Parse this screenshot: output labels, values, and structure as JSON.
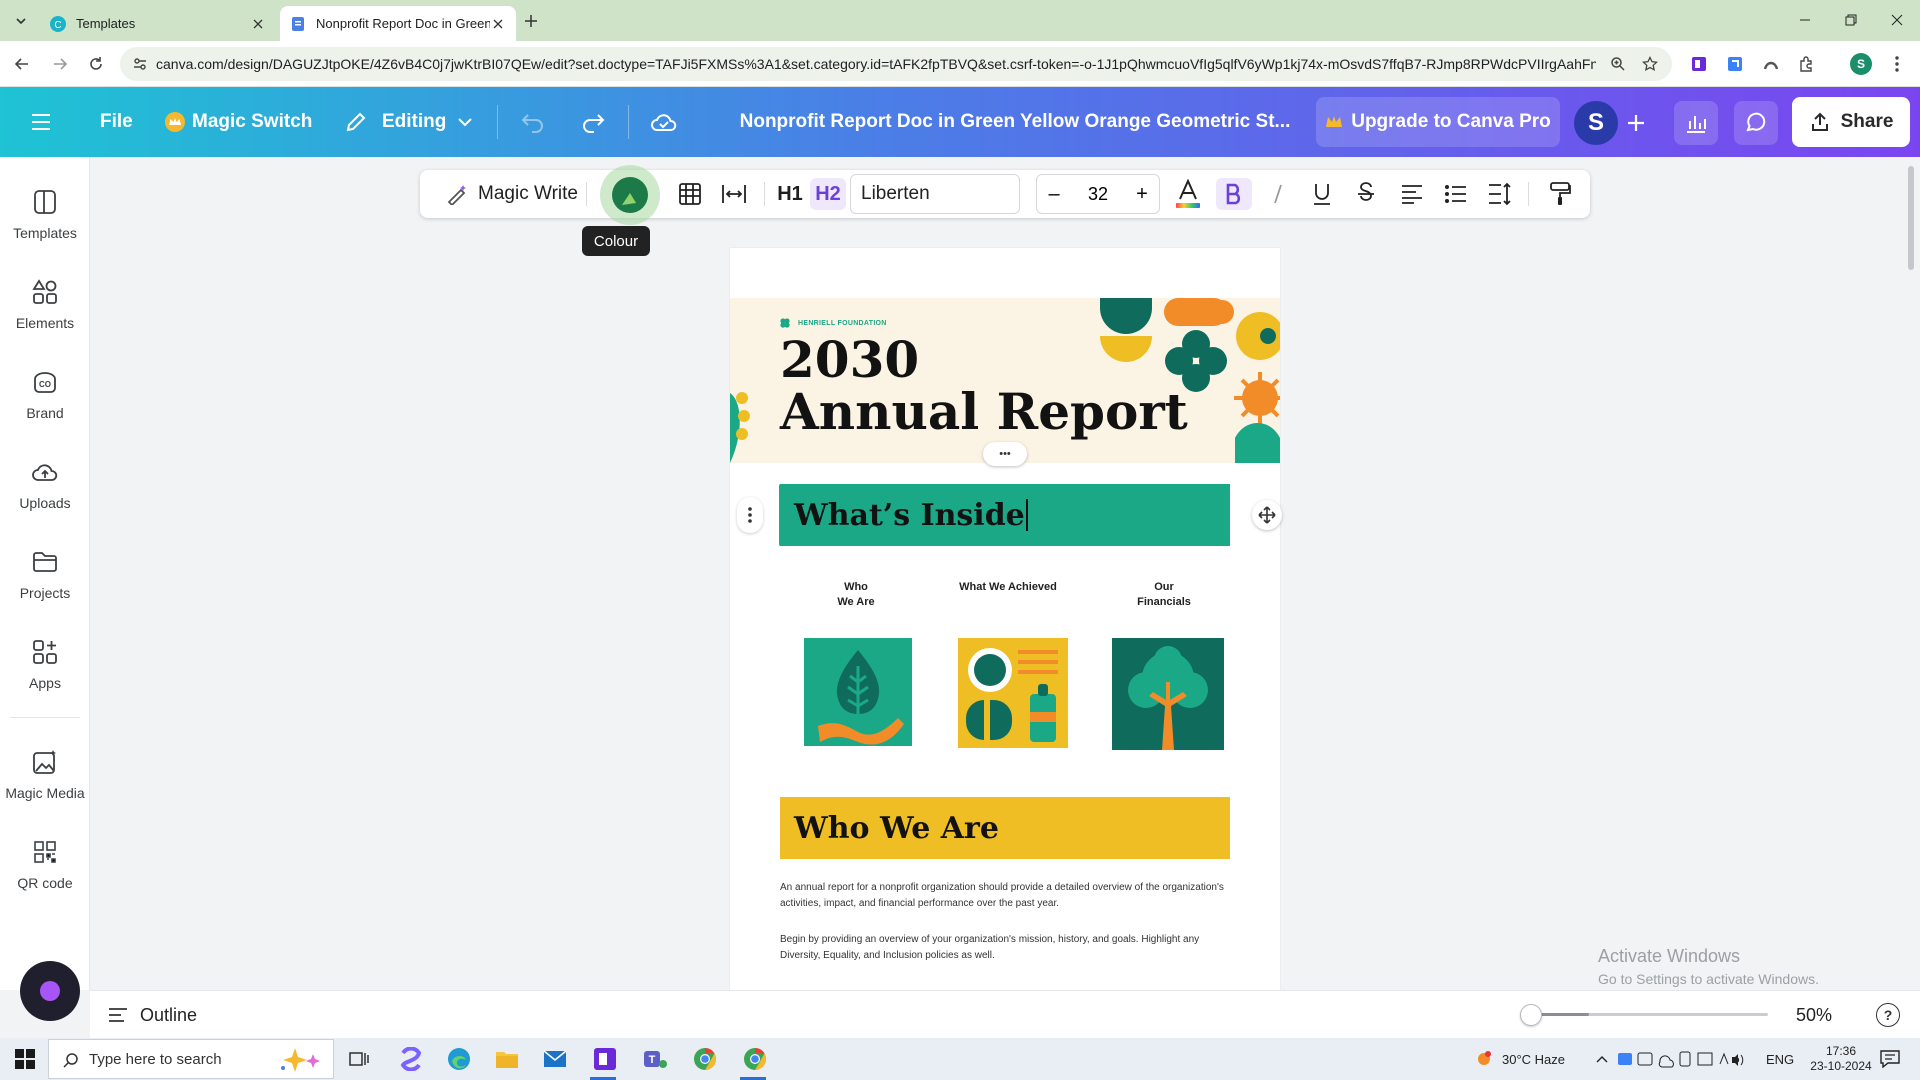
{
  "browser": {
    "tabs": [
      {
        "title": "Templates"
      },
      {
        "title": "Nonprofit Report Doc in Green"
      }
    ],
    "url": "canva.com/design/DAGUZJtpOKE/4Z6vB4C0j7jwKtrBI07QEw/edit?set.doctype=TAFJi5FXMSs%3A1&set.category.id=tAFK2fpTBVQ&set.csrf-token=-o-1J1pQhwmcuoVfIg5qlfV6yWp1kj74x-mOsvdS7ffqB7-RJmp8RPWdcPVIIrgAahFnOkE..."
  },
  "header": {
    "file": "File",
    "magic_switch": "Magic Switch",
    "editing": "Editing",
    "doc_title": "Nonprofit Report Doc in Green Yellow Orange Geometric St...",
    "upgrade": "Upgrade to Canva Pro",
    "avatar_letter": "S",
    "share": "Share"
  },
  "sidebar": {
    "items": [
      {
        "label": "Templates"
      },
      {
        "label": "Elements"
      },
      {
        "label": "Brand"
      },
      {
        "label": "Uploads"
      },
      {
        "label": "Projects"
      },
      {
        "label": "Apps"
      },
      {
        "label": "Magic Media"
      },
      {
        "label": "QR code"
      }
    ]
  },
  "toolbar": {
    "magic_write": "Magic Write",
    "font": "Liberten",
    "font_size": "32",
    "minus": "–",
    "plus": "+",
    "tooltip": "Colour",
    "h1": "H1",
    "h2": "H2"
  },
  "document": {
    "org": "HENRIELL FOUNDATION",
    "year": "2030",
    "title": "Annual Report",
    "more": "•••",
    "section1": "What’s Inside",
    "toc": [
      {
        "line1": "Who",
        "line2": "We Are"
      },
      {
        "line1": "What We Achieved",
        "line2": ""
      },
      {
        "line1": "Our",
        "line2": "Financials"
      }
    ],
    "section2": "Who We Are",
    "para1_line1": "An annual report for a nonprofit organization should provide a detailed overview of the organization's",
    "para1_line2": "activities, impact, and financial performance over the past year.",
    "para2_line1": "Begin by providing an overview of your organization's mission, history, and goals. Highlight any",
    "para2_line2": "Diversity, Equality, and Inclusion policies as well."
  },
  "bottom": {
    "outline": "Outline",
    "zoom": "50%",
    "zoom_level": 0.5,
    "help": "?"
  },
  "watermark": {
    "line1": "Activate Windows",
    "line2": "Go to Settings to activate Windows."
  },
  "taskbar": {
    "search_placeholder": "Type here to search",
    "weather": "30°C  Haze",
    "lang": "ENG",
    "time": "17:36",
    "date": "23-10-2024"
  },
  "colors": {
    "green": "#1ba886",
    "yellow": "#efbe25",
    "teal": "#0f6b5c",
    "orange": "#f28c28",
    "accent": "#7a45f0"
  },
  "icons": [
    "menu-icon",
    "crown-icon",
    "pencil-icon",
    "undo-icon",
    "redo-icon",
    "cloud-icon",
    "chart-icon",
    "comment-icon",
    "share-icon",
    "magic-write-icon",
    "colour-icon",
    "table-icon",
    "spacing-icon",
    "text-color-icon",
    "bold-icon",
    "italic-icon",
    "underline-icon",
    "strikethrough-icon",
    "align-icon",
    "list-icon",
    "line-spacing-icon",
    "format-painter-icon",
    "drag-move-icon",
    "kebab-icon"
  ]
}
